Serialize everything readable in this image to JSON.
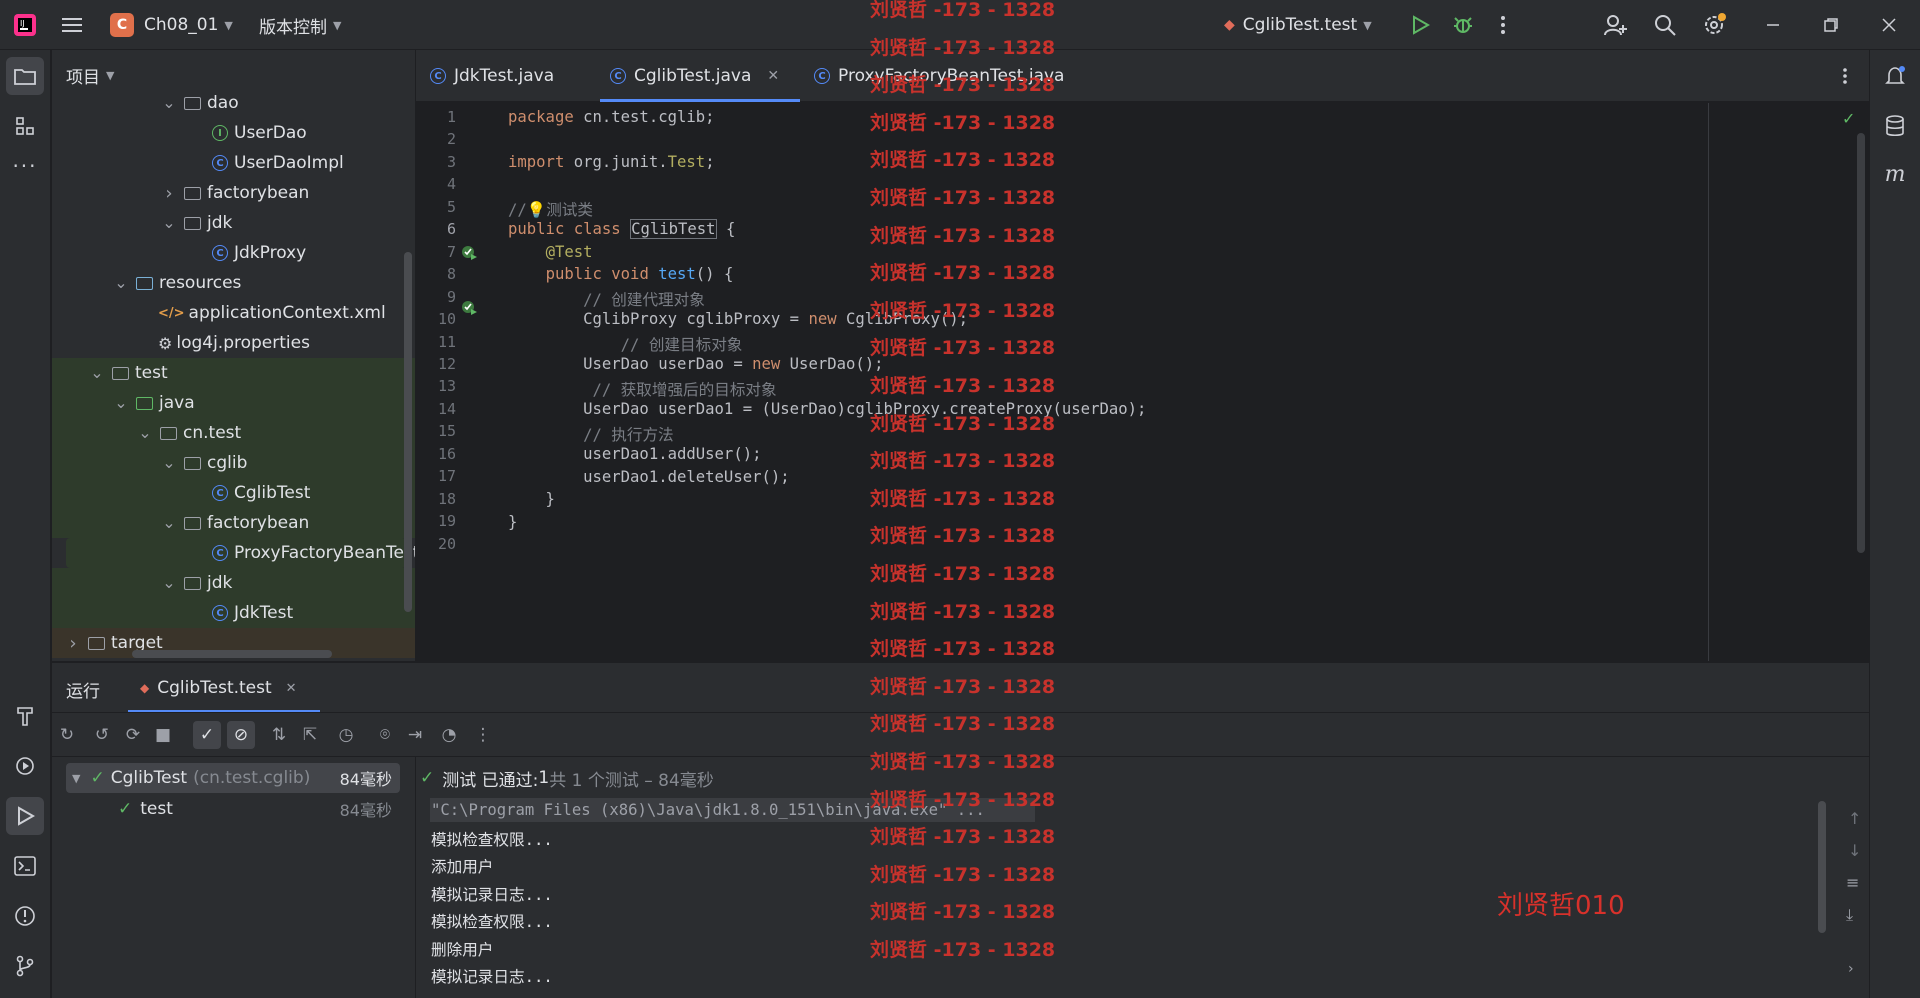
{
  "titlebar": {
    "project_initial": "C",
    "project_name": "Ch08_01",
    "vcs": "版本控制",
    "run_config": "CglibTest.test"
  },
  "project_panel": {
    "title": "项目",
    "tree": [
      {
        "label": "dao",
        "kind": "folder",
        "depth": 5,
        "expanded": true
      },
      {
        "label": "UserDao",
        "kind": "interface",
        "depth": 6
      },
      {
        "label": "UserDaoImpl",
        "kind": "class",
        "depth": 6
      },
      {
        "label": "factorybean",
        "kind": "folder",
        "depth": 5,
        "expanded": false
      },
      {
        "label": "jdk",
        "kind": "folder",
        "depth": 5,
        "expanded": true
      },
      {
        "label": "JdkProxy",
        "kind": "class",
        "depth": 6
      },
      {
        "label": "resources",
        "kind": "res-folder",
        "depth": 3,
        "expanded": true
      },
      {
        "label": "applicationContext.xml",
        "kind": "xml",
        "depth": 4
      },
      {
        "label": "log4j.properties",
        "kind": "props",
        "depth": 4
      },
      {
        "label": "test",
        "kind": "folder",
        "depth": 2,
        "expanded": true
      },
      {
        "label": "java",
        "kind": "test-src",
        "depth": 3,
        "expanded": true
      },
      {
        "label": "cn.test",
        "kind": "folder",
        "depth": 4,
        "expanded": true
      },
      {
        "label": "cglib",
        "kind": "folder",
        "depth": 5,
        "expanded": true
      },
      {
        "label": "CglibTest",
        "kind": "class",
        "depth": 6
      },
      {
        "label": "factorybean",
        "kind": "folder",
        "depth": 5,
        "expanded": true
      },
      {
        "label": "ProxyFactoryBeanTest",
        "kind": "class",
        "depth": 6
      },
      {
        "label": "jdk",
        "kind": "folder",
        "depth": 5,
        "expanded": true
      },
      {
        "label": "JdkTest",
        "kind": "class",
        "depth": 6
      },
      {
        "label": "target",
        "kind": "folder",
        "depth": 1,
        "expanded": false
      }
    ]
  },
  "editor": {
    "tabs": [
      {
        "label": "JdkTest.java"
      },
      {
        "label": "CglibTest.java"
      },
      {
        "label": "ProxyFactoryBeanTest.java"
      }
    ],
    "lines": [
      "1",
      "2",
      "3",
      "4",
      "5",
      "6",
      "7",
      "8",
      "9",
      "10",
      "11",
      "12",
      "13",
      "14",
      "15",
      "16",
      "17",
      "18",
      "19",
      "20"
    ]
  },
  "run_panel": {
    "title": "运行",
    "tab": "CglibTest.test",
    "tree": {
      "root_label": "CglibTest",
      "root_pkg": "(cn.test.cglib)",
      "root_time": "84毫秒",
      "child_label": "test",
      "child_time": "84毫秒"
    },
    "status": {
      "prefix": "测试 已通过: ",
      "count": "1",
      "suffix": "共 1 个测试 – 84毫秒"
    },
    "output": [
      "\"C:\\Program Files (x86)\\Java\\jdk1.8.0_151\\bin\\java.exe\" ...",
      "模拟检查权限...",
      "添加用户",
      "模拟记录日志...",
      "模拟检查权限...",
      "删除用户",
      "模拟记录日志..."
    ]
  },
  "watermark": {
    "text": "刘贤哲 -173 - 1328",
    "signature": "刘贤哲010"
  }
}
